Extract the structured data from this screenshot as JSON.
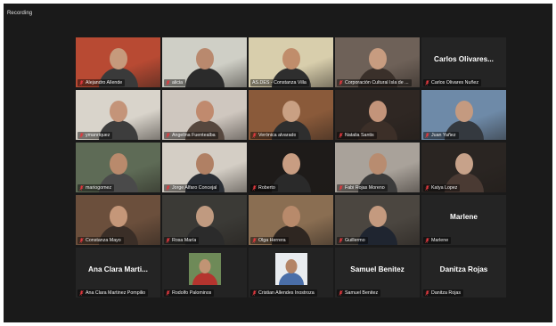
{
  "window": {
    "recording_label": "Recording"
  },
  "colors": {
    "active_speaker": "#d9e04a",
    "mic_off": "#e0393e",
    "tile_bg": "#242424"
  },
  "participants": [
    {
      "name": "Alejandro Allende",
      "big_name": "",
      "active": true,
      "mic_off": true,
      "kind": "video",
      "bg": "#b84a33",
      "skin": "#c69a7c",
      "shirt": "#3a3a3a"
    },
    {
      "name": "alicia",
      "big_name": "",
      "active": false,
      "mic_off": true,
      "kind": "video",
      "bg": "#cfcfc6",
      "skin": "#b9896e",
      "shirt": "#2b2b2b"
    },
    {
      "name": "AS.DES - Constanza Villa",
      "big_name": "",
      "active": false,
      "mic_off": false,
      "kind": "video",
      "bg": "#d8ceac",
      "skin": "#c08d6b",
      "shirt": "#2e2e2e"
    },
    {
      "name": "Corporación Cultural Isla de ...",
      "big_name": "",
      "active": false,
      "mic_off": true,
      "kind": "video",
      "bg": "#6e6158",
      "skin": "#c79c80",
      "shirt": "#3a302a"
    },
    {
      "name": "Carlos Olivares Nuñez",
      "big_name": "Carlos Olivares...",
      "active": false,
      "mic_off": true,
      "kind": "name",
      "bg": "",
      "skin": "",
      "shirt": ""
    },
    {
      "name": "ymanriquez",
      "big_name": "",
      "active": false,
      "mic_off": true,
      "kind": "video",
      "bg": "#d9d4cb",
      "skin": "#c49479",
      "shirt": "#3d3d3d"
    },
    {
      "name": "Angelina Fuentealba",
      "big_name": "",
      "active": false,
      "mic_off": true,
      "kind": "video",
      "bg": "#cfc7bf",
      "skin": "#c08a6e",
      "shirt": "#56473e"
    },
    {
      "name": "Verónica alvarado",
      "big_name": "",
      "active": false,
      "mic_off": true,
      "kind": "video",
      "bg": "#8a5a3a",
      "skin": "#c9a083",
      "shirt": "#2e2e2e"
    },
    {
      "name": "Natalia Santis",
      "big_name": "",
      "active": false,
      "mic_off": true,
      "kind": "video",
      "bg": "#2f2723",
      "skin": "#c3947a",
      "shirt": "#3c2f28"
    },
    {
      "name": "Juan Yañez",
      "big_name": "",
      "active": false,
      "mic_off": true,
      "kind": "video",
      "bg": "#6e8aa8",
      "skin": "#c49a80",
      "shirt": "#34393f"
    },
    {
      "name": "mariogomez",
      "big_name": "",
      "active": false,
      "mic_off": true,
      "kind": "video",
      "bg": "#5e6b56",
      "skin": "#b98a6c",
      "shirt": "#4a4a4a"
    },
    {
      "name": "Jorge Alfaro Concejal",
      "big_name": "",
      "active": false,
      "mic_off": true,
      "kind": "video",
      "bg": "#d4cec5",
      "skin": "#b08064",
      "shirt": "#2b2f36"
    },
    {
      "name": "Roberto",
      "big_name": "",
      "active": false,
      "mic_off": true,
      "kind": "video",
      "bg": "#1e1b19",
      "skin": "#c89d82",
      "shirt": "#2a2a2a"
    },
    {
      "name": "Fabi Rojas Moreno",
      "big_name": "",
      "active": false,
      "mic_off": true,
      "kind": "video",
      "bg": "#a9a29a",
      "skin": "#b88c70",
      "shirt": "#3b3b3b"
    },
    {
      "name": "Katya Lopez",
      "big_name": "",
      "active": false,
      "mic_off": true,
      "kind": "video",
      "bg": "#2a2522",
      "skin": "#c7a28a",
      "shirt": "#4a3a33"
    },
    {
      "name": "Constanza Mayo",
      "big_name": "",
      "active": false,
      "mic_off": true,
      "kind": "video",
      "bg": "#6b4f3c",
      "skin": "#c59779",
      "shirt": "#3a2e27"
    },
    {
      "name": "Rosa María",
      "big_name": "",
      "active": false,
      "mic_off": true,
      "kind": "video",
      "bg": "#3b3a36",
      "skin": "#c09a80",
      "shirt": "#2b2b2b"
    },
    {
      "name": "Olga Herrera",
      "big_name": "",
      "active": false,
      "mic_off": true,
      "kind": "video",
      "bg": "#8a6e52",
      "skin": "#b88a6b",
      "shirt": "#2e2621"
    },
    {
      "name": "Guillermo",
      "big_name": "",
      "active": false,
      "mic_off": true,
      "kind": "video",
      "bg": "#4b4640",
      "skin": "#c49a7f",
      "shirt": "#1f2530"
    },
    {
      "name": "Marlene",
      "big_name": "Marlene",
      "active": false,
      "mic_off": true,
      "kind": "name",
      "bg": "",
      "skin": "",
      "shirt": ""
    },
    {
      "name": "Ana Clara Martinez Pompilio",
      "big_name": "Ana Clara Marti...",
      "active": false,
      "mic_off": true,
      "kind": "name",
      "bg": "",
      "skin": "",
      "shirt": ""
    },
    {
      "name": "Rodolfo Palominos",
      "big_name": "",
      "active": false,
      "mic_off": true,
      "kind": "photo",
      "bg": "#6e8a58",
      "skin": "#c19474",
      "shirt": "#b4342e"
    },
    {
      "name": "Cristian Allendes Inostroza",
      "big_name": "",
      "active": false,
      "mic_off": true,
      "kind": "photo",
      "bg": "#e9ecef",
      "skin": "#b48466",
      "shirt": "#4a6ea8"
    },
    {
      "name": "Samuel Benitez",
      "big_name": "Samuel Benitez",
      "active": false,
      "mic_off": true,
      "kind": "name",
      "bg": "",
      "skin": "",
      "shirt": ""
    },
    {
      "name": "Danitza Rojas",
      "big_name": "Danitza Rojas",
      "active": false,
      "mic_off": true,
      "kind": "name",
      "bg": "",
      "skin": "",
      "shirt": ""
    }
  ]
}
